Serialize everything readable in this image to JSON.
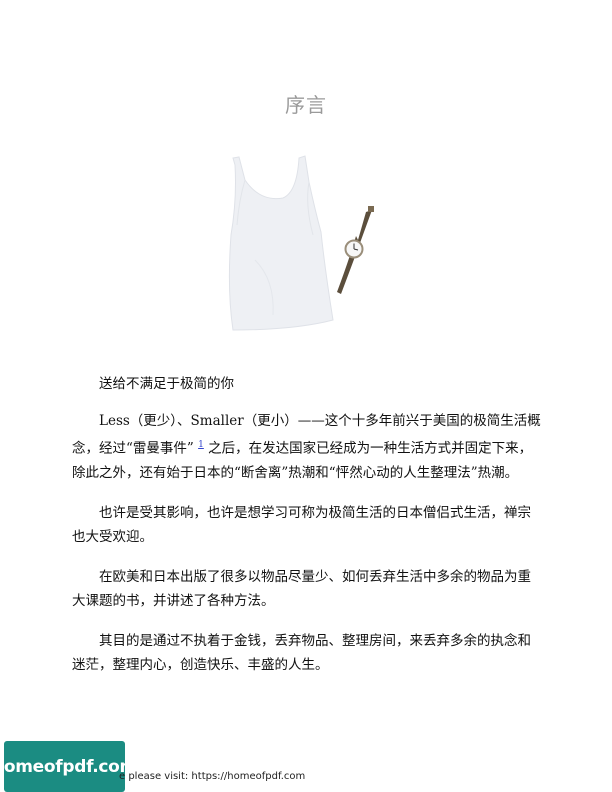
{
  "header": {
    "title": "序言"
  },
  "body": {
    "dedication": "送给不满足于极简的你",
    "p1_before": "Less（更少）、Smaller（更小）——这个十多年前兴于美国的极简生活概念，经过“雷曼事件” ",
    "p1_footnote": "1",
    "p1_after": " 之后，在发达国家已经成为一种生活方式并固定下来，除此之外，还有始于日本的“断舍离”热潮和“怦然心动的人生整理法”热潮。",
    "p2": "也许是受其影响，也许是想学习可称为极简生活的日本僧侣式生活，禅宗也大受欢迎。",
    "p3": "在欧美和日本出版了很多以物品尽量少、如何丢弃生活中多余的物品为重大课题的书，并讲述了各种方法。",
    "p4": "其目的是通过不执着于金钱，丢弃物品、整理房间，来丢弃多余的执念和迷茫，整理内心，创造快乐、丰盛的人生。"
  },
  "footer": {
    "logo": "homeofpdf.com",
    "text": "e please visit: https://homeofpdf.com"
  },
  "colors": {
    "title": "#9a9a9a",
    "logo_bg": "#1b8c82",
    "link": "#3344cc"
  }
}
